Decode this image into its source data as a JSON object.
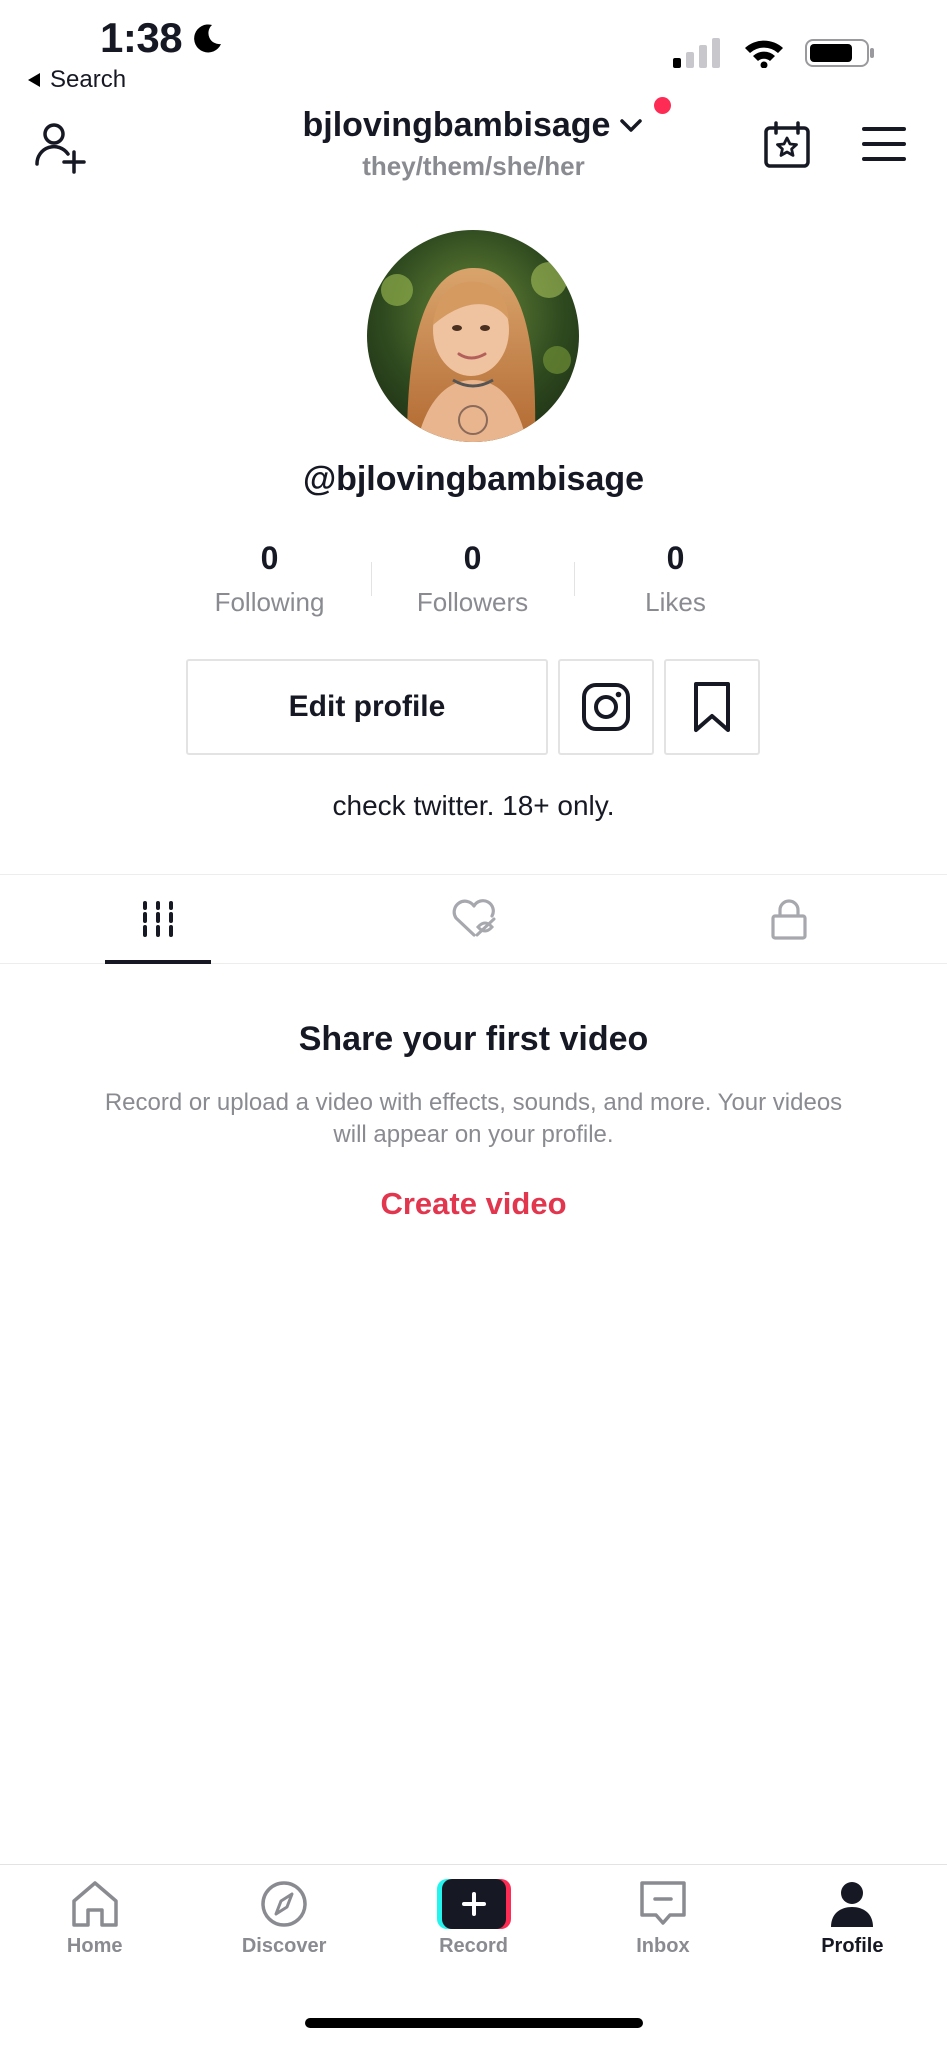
{
  "status_bar": {
    "time": "1:38",
    "back_label": "Search"
  },
  "header": {
    "username": "bjlovingbambisage",
    "pronouns": "they/them/she/her"
  },
  "profile": {
    "handle": "@bjlovingbambisage",
    "bio": "check twitter. 18+ only.",
    "stats": [
      {
        "value": "0",
        "label": "Following"
      },
      {
        "value": "0",
        "label": "Followers"
      },
      {
        "value": "0",
        "label": "Likes"
      }
    ],
    "edit_profile_label": "Edit profile"
  },
  "empty_state": {
    "title": "Share your first video",
    "description": "Record or upload a video with effects, sounds, and more. Your videos will appear on your profile.",
    "cta": "Create video"
  },
  "bottom_nav": [
    {
      "label": "Home",
      "icon": "home-icon"
    },
    {
      "label": "Discover",
      "icon": "compass-icon"
    },
    {
      "label": "Record",
      "icon": "plus-icon"
    },
    {
      "label": "Inbox",
      "icon": "inbox-icon"
    },
    {
      "label": "Profile",
      "icon": "person-icon",
      "active": true
    }
  ],
  "colors": {
    "accent": "#fe2c55",
    "create_link": "#e2354e",
    "text_primary": "#161823",
    "text_secondary": "#8a8b91"
  }
}
